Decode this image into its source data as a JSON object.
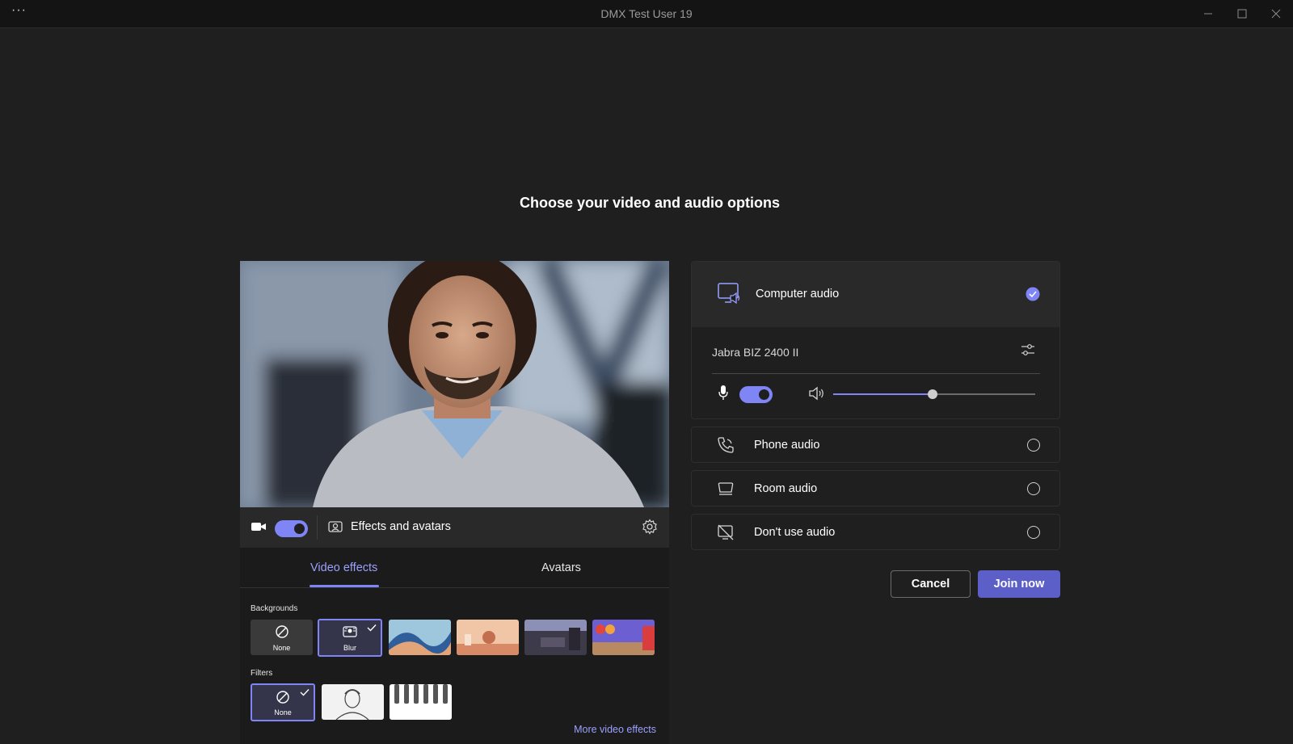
{
  "window": {
    "title": "DMX Test User 19",
    "more_label": "···"
  },
  "heading": "Choose your video and audio options",
  "video": {
    "camera_on": true,
    "effects_label": "Effects and avatars"
  },
  "effects": {
    "tabs": [
      {
        "label": "Video effects",
        "selected": true
      },
      {
        "label": "Avatars",
        "selected": false
      }
    ],
    "backgrounds_label": "Backgrounds",
    "backgrounds": [
      {
        "label": "None",
        "icon": "none-icon",
        "selected": false
      },
      {
        "label": "Blur",
        "icon": "blur-icon",
        "selected": true
      },
      {
        "label": "",
        "theme": "abstract waves",
        "selected": false
      },
      {
        "label": "",
        "theme": "peach room",
        "selected": false
      },
      {
        "label": "",
        "theme": "dark lounge",
        "selected": false
      },
      {
        "label": "",
        "theme": "colorful office",
        "selected": false
      }
    ],
    "filters_label": "Filters",
    "filters": [
      {
        "label": "None",
        "icon": "none-icon",
        "selected": true
      },
      {
        "label": "",
        "theme": "sketch",
        "selected": false
      },
      {
        "label": "",
        "theme": "piano",
        "selected": false
      }
    ],
    "more_link": "More video effects"
  },
  "audio": {
    "computer_audio": {
      "label": "Computer audio",
      "selected": true,
      "device": "Jabra BIZ 2400 II",
      "mic_on": true,
      "volume_fraction": 0.49
    },
    "options": [
      {
        "label": "Phone audio",
        "icon": "phone-icon",
        "selected": false
      },
      {
        "label": "Room audio",
        "icon": "room-icon",
        "selected": false
      },
      {
        "label": "Don't use audio",
        "icon": "no-audio-icon",
        "selected": false
      }
    ]
  },
  "buttons": {
    "cancel": "Cancel",
    "join": "Join now"
  },
  "colors": {
    "accent": "#7f85f5",
    "primary_button": "#5b5fc7",
    "background": "#1f1f1f"
  }
}
